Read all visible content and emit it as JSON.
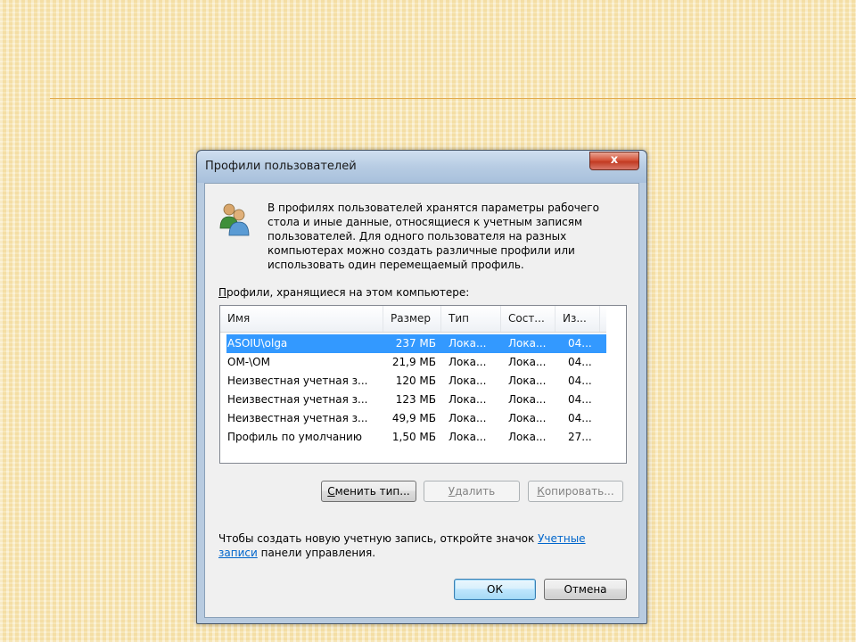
{
  "dialog": {
    "title": "Профили пользователей",
    "close_glyph": "x",
    "intro_text": "В профилях пользователей хранятся параметры рабочего стола и иные данные, относящиеся к учетным записям пользователей. Для одного пользователя на разных компьютерах можно создать различные профили или использовать один перемещаемый профиль.",
    "list_label_accel": "П",
    "list_label_rest": "рофили, хранящиеся на этом компьютере:",
    "columns": [
      "Имя",
      "Размер",
      "Тип",
      "Сост...",
      "Из..."
    ],
    "rows": [
      {
        "name": "ASOIU\\olga",
        "size": "237 МБ",
        "type": "Лока...",
        "state": "Лока...",
        "changed": "04...",
        "selected": true
      },
      {
        "name": "OM-\\OM",
        "size": "21,9 МБ",
        "type": "Лока...",
        "state": "Лока...",
        "changed": "04...",
        "selected": false
      },
      {
        "name": "Неизвестная учетная з...",
        "size": "120 МБ",
        "type": "Лока...",
        "state": "Лока...",
        "changed": "04...",
        "selected": false
      },
      {
        "name": "Неизвестная учетная з...",
        "size": "123 МБ",
        "type": "Лока...",
        "state": "Лока...",
        "changed": "04...",
        "selected": false
      },
      {
        "name": "Неизвестная учетная з...",
        "size": "49,9 МБ",
        "type": "Лока...",
        "state": "Лока...",
        "changed": "04...",
        "selected": false
      },
      {
        "name": "Профиль по умолчанию",
        "size": "1,50 МБ",
        "type": "Лока...",
        "state": "Лока...",
        "changed": "27...",
        "selected": false
      }
    ],
    "buttons": {
      "change_type": {
        "accel": "С",
        "rest": "менить тип..."
      },
      "delete": {
        "accel": "У",
        "rest": "далить"
      },
      "copy": {
        "accel": "К",
        "rest": "опировать..."
      }
    },
    "footer_text_before": "Чтобы создать новую учетную запись, откройте значок ",
    "footer_link": "Учетные записи",
    "footer_text_after": " панели управления.",
    "ok_label": "ОК",
    "cancel_label": "Отмена"
  },
  "colors": {
    "selection": "#3399ff",
    "link": "#0066cc",
    "slide_line": "#e0a94a"
  }
}
